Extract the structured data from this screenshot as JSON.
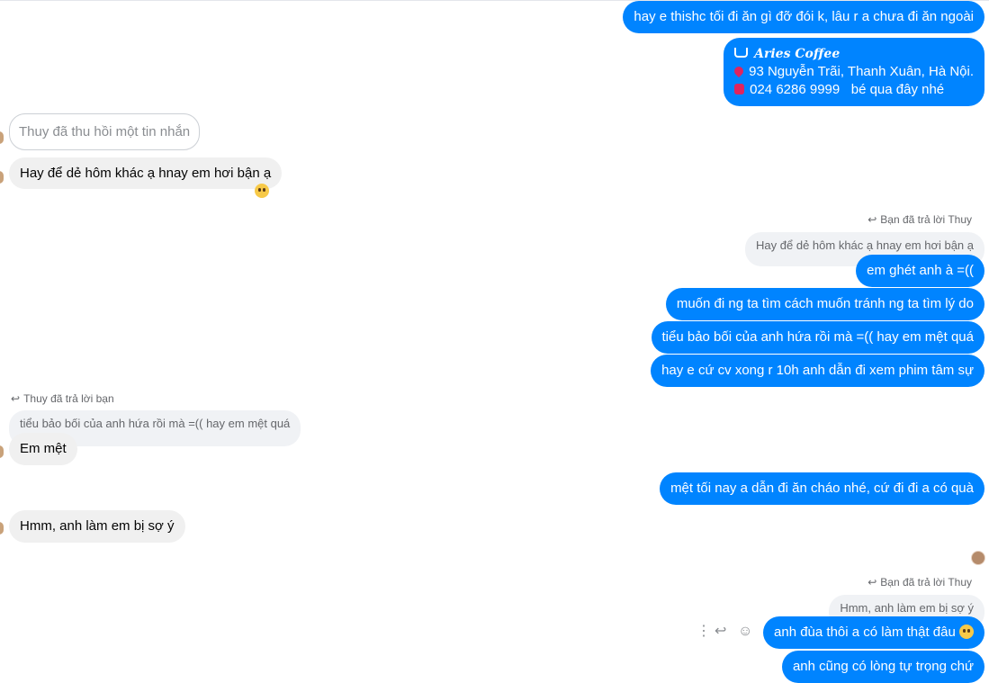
{
  "messages": {
    "m1": "hay e thishc tối đi ăn gì đỡ đói k, lâu r a chưa đi ăn ngoài",
    "coffee": {
      "name": "Aries Coffee",
      "address": "93 Nguyễn Trãi, Thanh Xuân, Hà Nội.",
      "phone": "024 6286 9999   bé qua đây nhé"
    },
    "recalled": "Thuy đã thu hồi một tin nhắn",
    "m3": "Hay để dẻ hôm khác ạ hnay em hơi bận ạ",
    "reply1_label": "Bạn đã trả lời Thuy",
    "reply1_quote": "Hay để dẻ hôm khác ạ hnay em hơi bận ạ",
    "m4": "em ghét anh à =((",
    "m5": "muốn đi ng ta tìm cách muốn tránh ng ta tìm lý do",
    "m6": "tiểu bảo bối của anh hứa rồi mà =(( hay em mệt quá",
    "m7": "hay e cứ cv xong r 10h anh dẫn đi xem phim tâm sự",
    "reply2_label": "Thuy đã trả lời bạn",
    "reply2_quote": "tiểu bảo bối của anh hứa rồi mà =(( hay em mệt quá",
    "m8": "Em mệt",
    "m9": "mệt tối nay a dẫn đi ăn cháo nhé, cứ đi đi a có quà",
    "m10": "Hmm, anh làm em bị sợ ý",
    "reply3_label": "Bạn đã trả lời Thuy",
    "reply3_quote": "Hmm, anh làm em bị sợ ý",
    "m11": "anh đùa thôi a có làm thật đâu",
    "m12": "anh cũng có lòng tự trọng chứ"
  },
  "icons": {
    "reply_arrow": "reply-arrow-icon",
    "more": "more-options-icon",
    "reply": "reply-icon",
    "react": "react-smiley-icon"
  },
  "colors": {
    "outgoing": "#0084ff",
    "incoming": "#f0f0f0"
  }
}
